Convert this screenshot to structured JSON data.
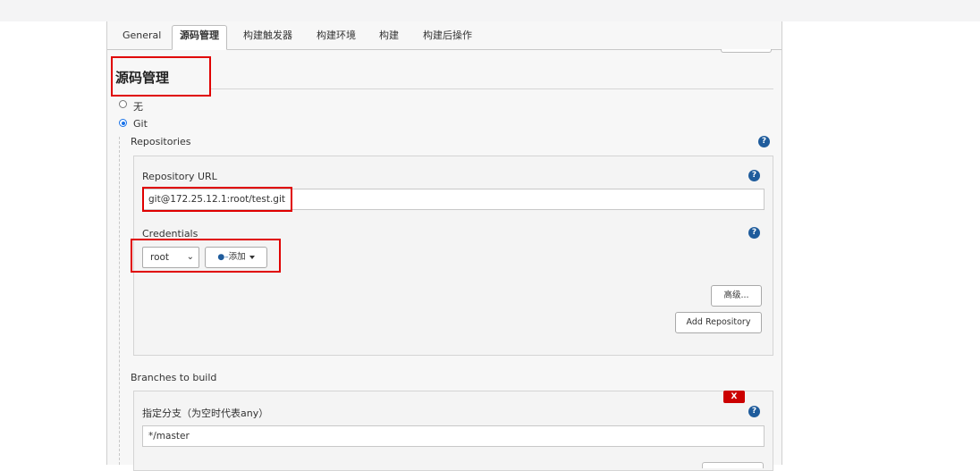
{
  "tabs": [
    {
      "label": "General"
    },
    {
      "label": "源码管理"
    },
    {
      "label": "构建触发器"
    },
    {
      "label": "构建环境"
    },
    {
      "label": "构建"
    },
    {
      "label": "构建后操作"
    }
  ],
  "active_tab": "源码管理",
  "section": {
    "title": "源码管理"
  },
  "scm": {
    "options": [
      {
        "label": "无",
        "selected": false
      },
      {
        "label": "Git",
        "selected": true
      }
    ]
  },
  "repositories": {
    "label": "Repositories",
    "url_label": "Repository URL",
    "url_value": "git@172.25.12.1:root/test.git",
    "credentials_label": "Credentials",
    "credentials_value": "root",
    "add_button": "添加",
    "advanced_button": "高级...",
    "add_repository_button": "Add Repository"
  },
  "branches": {
    "label": "Branches to build",
    "delete_button": "X",
    "specifier_label": "指定分支（为空时代表any）",
    "specifier_value": "*/master"
  },
  "help_icon_text": "?",
  "colors": {
    "highlight": "#e00000",
    "help": "#1f5c9c",
    "delete": "#cc0000"
  }
}
